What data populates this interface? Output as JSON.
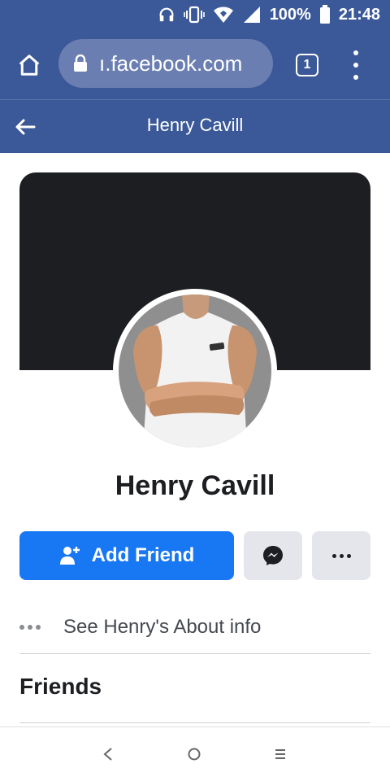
{
  "status_bar": {
    "battery_percent": "100%",
    "time": "21:48",
    "icons": [
      "headphones-icon",
      "vibrate-icon",
      "data-saver-icon",
      "signal-icon",
      "battery-icon"
    ]
  },
  "browser": {
    "url": "ı.facebook.com",
    "tab_count": "1",
    "icons": [
      "home-icon",
      "lock-icon",
      "tabs-icon",
      "overflow-menu-icon"
    ]
  },
  "header": {
    "title": "Henry Cavill"
  },
  "profile": {
    "name": "Henry Cavill"
  },
  "actions": {
    "add_friend_label": "Add Friend"
  },
  "about": {
    "label": "See Henry's About info"
  },
  "friends": {
    "title": "Friends"
  },
  "colors": {
    "brand_header": "#3b5998",
    "primary_button": "#1877f2",
    "secondary_button": "#e4e6eb",
    "cover": "#1c1e21",
    "text_primary": "#1c1e21"
  },
  "navigation": {
    "icons": [
      "back-nav-icon",
      "home-nav-icon",
      "recents-nav-icon"
    ]
  }
}
